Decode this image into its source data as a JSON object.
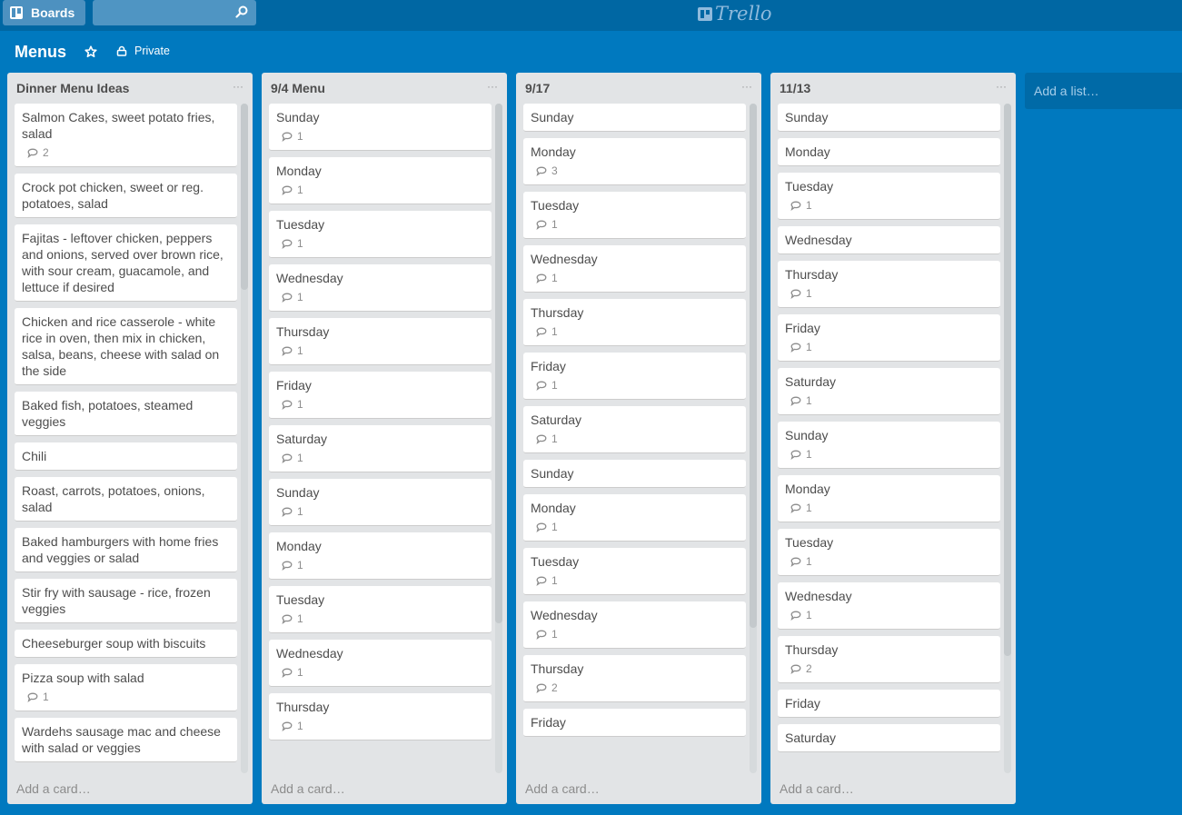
{
  "topbar": {
    "boards_label": "Boards",
    "search_placeholder": "",
    "logo_text": "Trello"
  },
  "board": {
    "title": "Menus",
    "visibility": "Private"
  },
  "lists": [
    {
      "title": "Dinner Menu Ideas",
      "menu": "···",
      "add_card": "Add a card…",
      "cards": [
        {
          "title": "Salmon Cakes, sweet potato fries, salad",
          "comments": "2"
        },
        {
          "title": "Crock pot chicken, sweet or reg. potatoes, salad",
          "comments": null
        },
        {
          "title": "Fajitas - leftover chicken, peppers and onions, served over brown rice, with sour cream, guacamole, and lettuce if desired",
          "comments": null
        },
        {
          "title": "Chicken and rice casserole - white rice in oven, then mix in chicken, salsa, beans, cheese with salad on the side",
          "comments": null
        },
        {
          "title": "Baked fish, potatoes, steamed veggies",
          "comments": null
        },
        {
          "title": "Chili",
          "comments": null
        },
        {
          "title": "Roast, carrots, potatoes, onions, salad",
          "comments": null
        },
        {
          "title": "Baked hamburgers with home fries and veggies or salad",
          "comments": null
        },
        {
          "title": "Stir fry with sausage - rice, frozen veggies",
          "comments": null
        },
        {
          "title": "Cheeseburger soup with biscuits",
          "comments": null
        },
        {
          "title": "Pizza soup with salad",
          "comments": "1"
        },
        {
          "title": "Wardehs sausage mac and cheese with salad or veggies",
          "comments": null
        }
      ]
    },
    {
      "title": "9/4 Menu",
      "menu": "···",
      "add_card": "Add a card…",
      "cards": [
        {
          "title": "Sunday",
          "comments": "1"
        },
        {
          "title": "Monday",
          "comments": "1"
        },
        {
          "title": "Tuesday",
          "comments": "1"
        },
        {
          "title": "Wednesday",
          "comments": "1"
        },
        {
          "title": "Thursday",
          "comments": "1"
        },
        {
          "title": "Friday",
          "comments": "1"
        },
        {
          "title": "Saturday",
          "comments": "1"
        },
        {
          "title": "Sunday",
          "comments": "1"
        },
        {
          "title": "Monday",
          "comments": "1"
        },
        {
          "title": "Tuesday",
          "comments": "1"
        },
        {
          "title": "Wednesday",
          "comments": "1"
        },
        {
          "title": "Thursday",
          "comments": "1"
        }
      ]
    },
    {
      "title": "9/17",
      "menu": "···",
      "add_card": "Add a card…",
      "cards": [
        {
          "title": "Sunday",
          "comments": null
        },
        {
          "title": "Monday",
          "comments": "3"
        },
        {
          "title": "Tuesday",
          "comments": "1"
        },
        {
          "title": "Wednesday",
          "comments": "1"
        },
        {
          "title": "Thursday",
          "comments": "1"
        },
        {
          "title": "Friday",
          "comments": "1"
        },
        {
          "title": "Saturday",
          "comments": "1"
        },
        {
          "title": "Sunday",
          "comments": null
        },
        {
          "title": "Monday",
          "comments": "1"
        },
        {
          "title": "Tuesday",
          "comments": "1"
        },
        {
          "title": "Wednesday",
          "comments": "1"
        },
        {
          "title": "Thursday",
          "comments": "2"
        },
        {
          "title": "Friday",
          "comments": null
        }
      ]
    },
    {
      "title": "11/13",
      "menu": "···",
      "add_card": "Add a card…",
      "cards": [
        {
          "title": "Sunday",
          "comments": null
        },
        {
          "title": "Monday",
          "comments": null
        },
        {
          "title": "Tuesday",
          "comments": "1"
        },
        {
          "title": "Wednesday",
          "comments": null
        },
        {
          "title": "Thursday",
          "comments": "1"
        },
        {
          "title": "Friday",
          "comments": "1"
        },
        {
          "title": "Saturday",
          "comments": "1"
        },
        {
          "title": "Sunday",
          "comments": "1"
        },
        {
          "title": "Monday",
          "comments": "1"
        },
        {
          "title": "Tuesday",
          "comments": "1"
        },
        {
          "title": "Wednesday",
          "comments": "1"
        },
        {
          "title": "Thursday",
          "comments": "2"
        },
        {
          "title": "Friday",
          "comments": null
        },
        {
          "title": "Saturday",
          "comments": null
        }
      ]
    }
  ],
  "add_list_label": "Add a list…",
  "colors": {
    "board_bg": "#0079bf",
    "header_bg": "#0067a3",
    "list_bg": "#e2e4e6",
    "card_bg": "#ffffff"
  }
}
